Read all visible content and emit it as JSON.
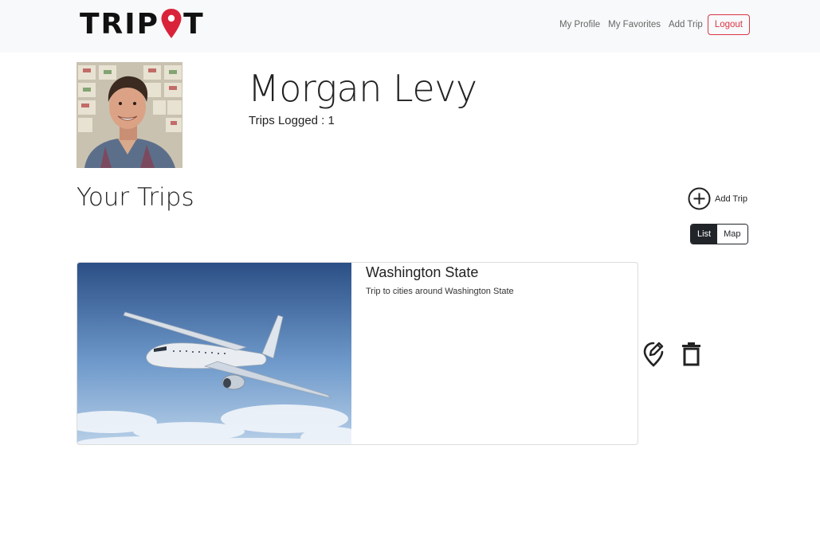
{
  "navbar": {
    "brand": "TRIPIT",
    "brand_prefix": "TRIP",
    "brand_suffix": "T",
    "brand_pin_color": "#d9233a",
    "links": [
      "My Profile",
      "My Favorites",
      "Add Trip"
    ],
    "logout_label": "Logout"
  },
  "profile": {
    "name": "Morgan Levy",
    "trips_logged": "Trips Logged : 1"
  },
  "trips_section": {
    "title": "Your Trips",
    "add_trip_label": "Add Trip",
    "add_trip_icon": "plus-circle-icon",
    "view_toggle": {
      "list_label": "List",
      "map_label": "Map",
      "selected": "List"
    }
  },
  "trips": [
    {
      "title": "Washington State",
      "description": "Trip to cities around Washington State",
      "image": "airplane-photo",
      "actions": [
        "edit-location-icon",
        "trash-icon"
      ]
    }
  ]
}
